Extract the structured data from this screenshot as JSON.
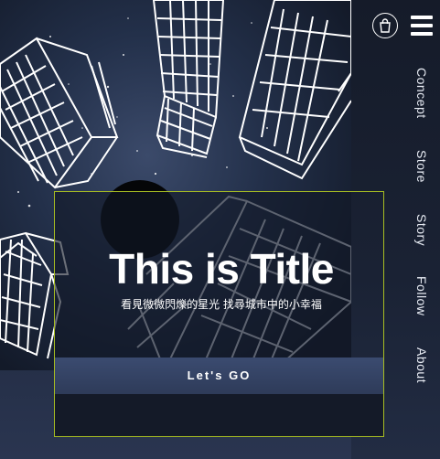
{
  "hero": {
    "title": "This is Title",
    "subtitle": "看見微微閃爍的星光 找尋城市中的小幸福",
    "button_label": "Let's GO"
  },
  "header": {
    "cart_icon": "shopping-bag-icon",
    "menu_icon": "hamburger-menu-icon"
  },
  "nav": {
    "items": [
      {
        "label": "Concept"
      },
      {
        "label": "Store"
      },
      {
        "label": "Story"
      },
      {
        "label": "Follow"
      },
      {
        "label": "About"
      }
    ]
  },
  "colors": {
    "accent_border": "#a7bd22",
    "button": "#34436a",
    "background": "#1d2436"
  }
}
